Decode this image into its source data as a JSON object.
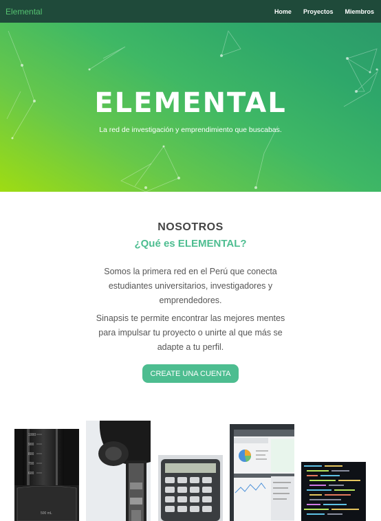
{
  "navbar": {
    "brand": "Elemental",
    "links": [
      "Home",
      "Proyectos",
      "Miembros"
    ]
  },
  "hero": {
    "title": "ELEMENTAL",
    "subtitle": "La red de investigación y emprendimiento que buscabas."
  },
  "about": {
    "kicker": "NOSOTROS",
    "title": "¿Qué es ELEMENTAL?",
    "paragraph1": "Somos la primera red en el Perú que conecta estudiantes universitarios, investigadores y emprendedores.",
    "paragraph2": "Sinapsis te permite encontrar las mejores mentes para impulsar tu proyecto o unirte al que más se adapte a tu perfil.",
    "cta_label": "CREATE UNA CUENTA"
  },
  "gallery": [
    {
      "name": "graduated-cylinder-photo",
      "label": "500 mL",
      "scale": [
        "1000",
        "900",
        "800",
        "700",
        "600"
      ]
    },
    {
      "name": "microscope-photo"
    },
    {
      "name": "calculator-photo"
    },
    {
      "name": "analytics-dashboard-photo"
    },
    {
      "name": "code-editor-photo"
    }
  ],
  "colors": {
    "navbar_bg": "#1f4a3a",
    "brand": "#55c271",
    "accent": "#4dbd90",
    "hero_gradient_start": "#9fdc12",
    "hero_gradient_end": "#2c9a6a"
  }
}
